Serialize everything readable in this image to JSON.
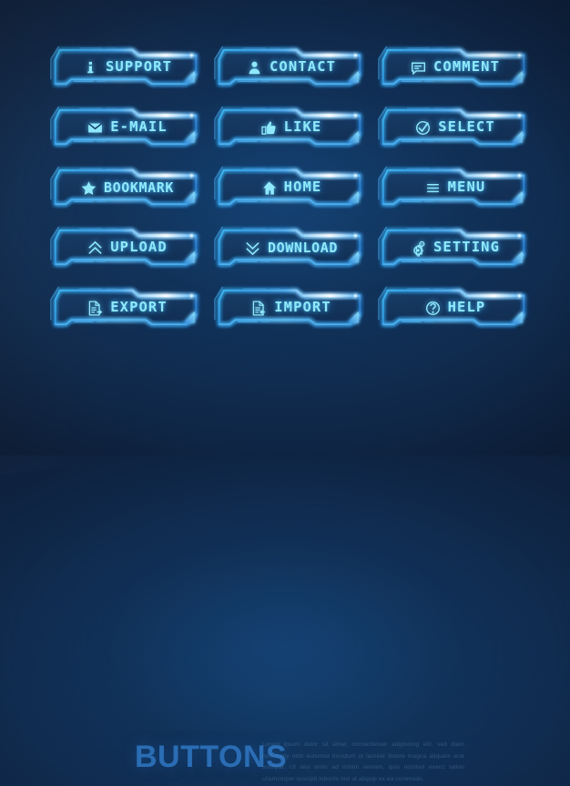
{
  "theme": {
    "bg_dark": "#101c2b",
    "bg_mid": "#102b4e",
    "bg_light": "#123963",
    "accent_cyan": "#8fe9fb",
    "accent_blue": "#2f9ae8",
    "glow": "#5acdff",
    "title_blue": "#2a6db4"
  },
  "buttons": [
    {
      "label": "SUPPORT",
      "icon": "info-icon"
    },
    {
      "label": "CONTACT",
      "icon": "user-icon"
    },
    {
      "label": "COMMENT",
      "icon": "comment-bubble-icon"
    },
    {
      "label": "E-MAIL",
      "icon": "envelope-icon"
    },
    {
      "label": "LIKE",
      "icon": "thumbs-up-icon"
    },
    {
      "label": "SELECT",
      "icon": "check-circle-icon"
    },
    {
      "label": "BOOKMARK",
      "icon": "star-icon"
    },
    {
      "label": "HOME",
      "icon": "home-icon"
    },
    {
      "label": "MENU",
      "icon": "hamburger-menu-icon"
    },
    {
      "label": "UPLOAD",
      "icon": "double-chevron-up-icon"
    },
    {
      "label": "DOWNLOAD",
      "icon": "double-chevron-down-icon"
    },
    {
      "label": "SETTING",
      "icon": "gears-icon"
    },
    {
      "label": "EXPORT",
      "icon": "document-export-icon"
    },
    {
      "label": "IMPORT",
      "icon": "document-import-icon"
    },
    {
      "label": "HELP",
      "icon": "question-circle-icon"
    }
  ],
  "footer": {
    "title": "BUTTONS",
    "blurb": "Lorem ipsum dolor sit amet, consectetuer adipiscing elit, sed diam nonummy nibh euismod tincidunt ut laoreet dolore magna aliquam erat volutpat. Ut wisi enim ad minim veniam, quis nostrud exerci tation ullamcorper suscipit lobortis nisl ut aliquip ex ea commodo."
  }
}
